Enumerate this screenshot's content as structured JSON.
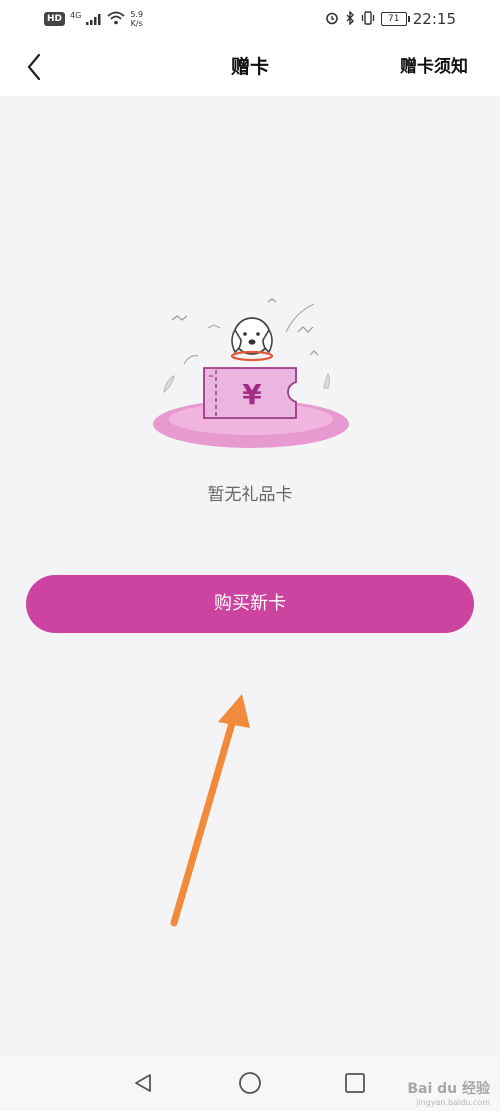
{
  "status_bar": {
    "hd": "HD",
    "network": "4G",
    "speed_value": "5.9",
    "speed_unit": "K/s",
    "battery": "71",
    "time": "22:15"
  },
  "header": {
    "title": "赠卡",
    "right_link": "赠卡须知"
  },
  "empty_state": {
    "message": "暂无礼品卡",
    "card_symbol": "¥"
  },
  "actions": {
    "buy_new_card": "购买新卡"
  },
  "watermark": {
    "brand": "Bai du 经验",
    "url": "jingyan.baidu.com"
  },
  "colors": {
    "accent": "#cc449f",
    "annotation": "#f28a3c"
  }
}
